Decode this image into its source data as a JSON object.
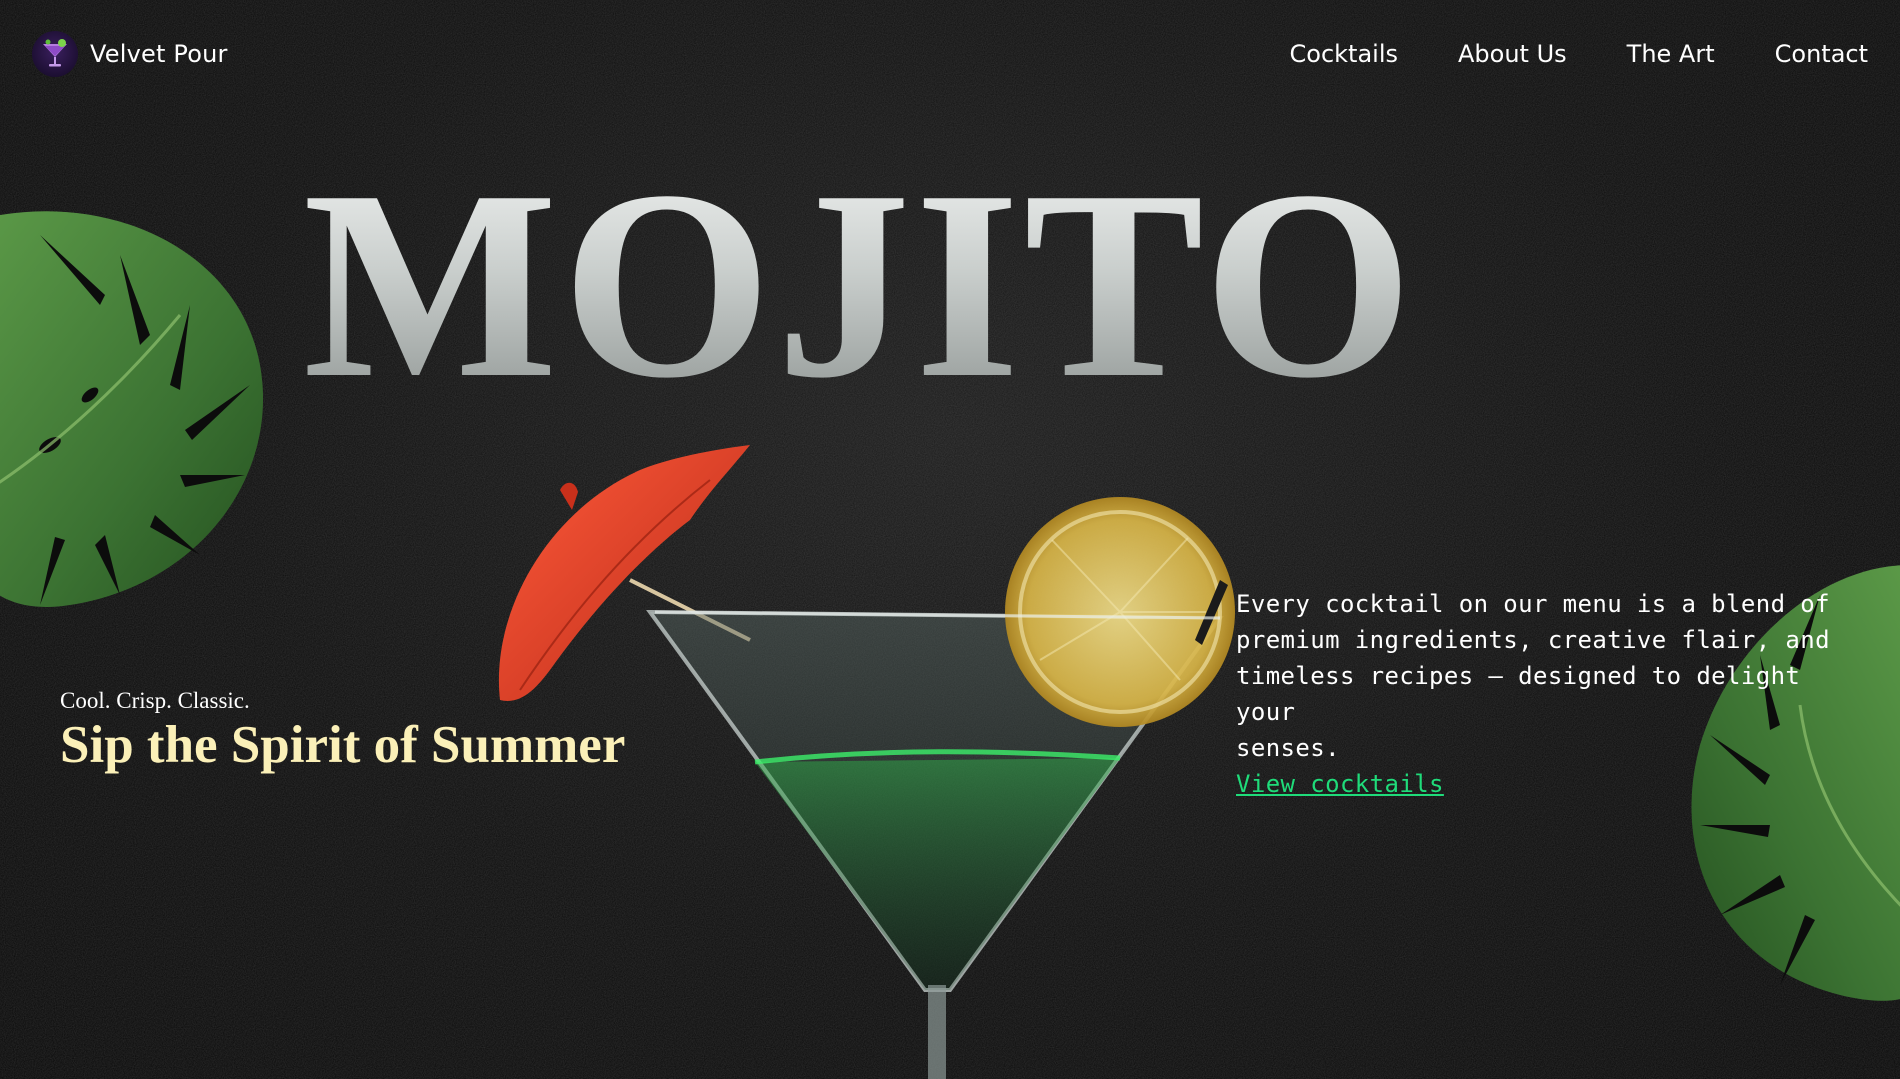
{
  "brand": {
    "logo_icon": "cocktail-glass-icon",
    "name": "Velvet Pour"
  },
  "nav": {
    "items": [
      {
        "label": "Cocktails"
      },
      {
        "label": "About Us"
      },
      {
        "label": "The Art"
      },
      {
        "label": "Contact"
      }
    ]
  },
  "hero": {
    "title": "MOJITO",
    "tagline": "Cool. Crisp. Classic.",
    "subtitle": "Sip the Spirit of Summer",
    "description": "Every cocktail on our menu is a blend of\npremium ingredients, creative flair, and\ntimeless recipes — designed to delight your\nsenses.",
    "cta_label": "View cocktails"
  },
  "colors": {
    "background": "#0b0b0b",
    "subtitle": "#fbf0b8",
    "cta": "#1fdc7a",
    "umbrella": "#e8452b",
    "lemon": "#e6c65c",
    "leaf": "#3f7a35"
  },
  "decor": {
    "leaf_icon": "monstera-leaf-icon",
    "glass_icon": "martini-glass-icon",
    "umbrella_icon": "cocktail-umbrella-icon",
    "lemon_icon": "lemon-slice-icon"
  }
}
